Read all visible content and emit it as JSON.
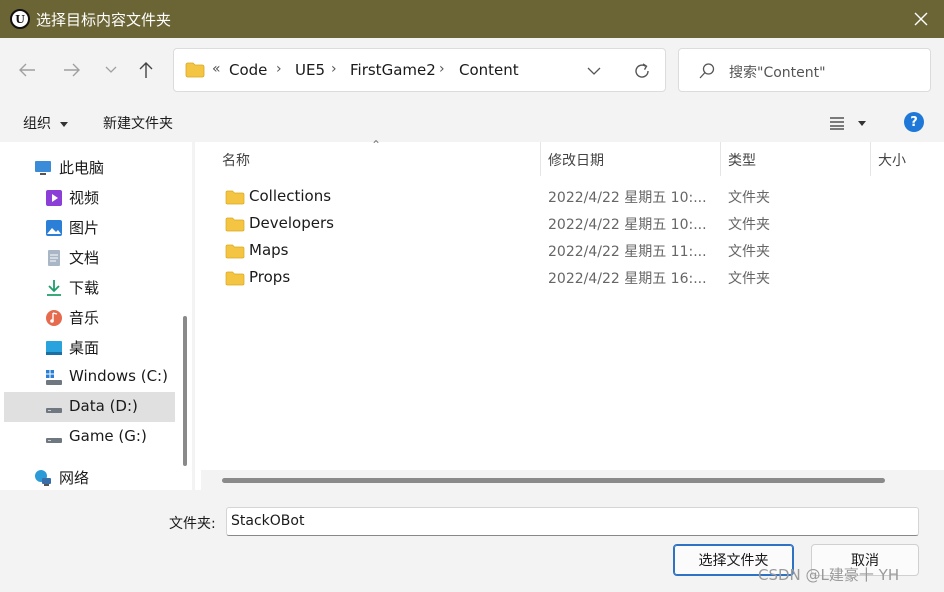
{
  "window": {
    "title": "选择目标内容文件夹",
    "app_icon_letter": "U"
  },
  "address_bar": {
    "overflow": "«",
    "crumbs": [
      "Code",
      "UE5",
      "FirstGame2",
      "Content"
    ]
  },
  "search": {
    "placeholder": "搜索\"Content\""
  },
  "toolbar": {
    "organize_label": "组织",
    "new_folder_label": "新建文件夹"
  },
  "sidebar": {
    "items": [
      {
        "label": "此电脑",
        "icon": "computer-icon"
      },
      {
        "label": "视频",
        "icon": "videos-icon"
      },
      {
        "label": "图片",
        "icon": "pictures-icon"
      },
      {
        "label": "文档",
        "icon": "documents-icon"
      },
      {
        "label": "下载",
        "icon": "downloads-icon"
      },
      {
        "label": "音乐",
        "icon": "music-icon"
      },
      {
        "label": "桌面",
        "icon": "desktop-icon"
      },
      {
        "label": "Windows (C:)",
        "icon": "windows-drive-icon"
      },
      {
        "label": "Data (D:)",
        "icon": "drive-icon",
        "selected": true
      },
      {
        "label": "Game (G:)",
        "icon": "drive-icon"
      },
      {
        "label": "网络",
        "icon": "network-icon"
      }
    ]
  },
  "file_list": {
    "columns": [
      "名称",
      "修改日期",
      "类型",
      "大小"
    ],
    "rows": [
      {
        "name": "Collections",
        "date": "2022/4/22 星期五 10:...",
        "type": "文件夹"
      },
      {
        "name": "Developers",
        "date": "2022/4/22 星期五 10:...",
        "type": "文件夹"
      },
      {
        "name": "Maps",
        "date": "2022/4/22 星期五 11:...",
        "type": "文件夹"
      },
      {
        "name": "Props",
        "date": "2022/4/22 星期五 16:...",
        "type": "文件夹"
      }
    ]
  },
  "footer": {
    "folder_label": "文件夹:",
    "folder_value": "StackOBot",
    "select_button": "选择文件夹",
    "cancel_button": "取消",
    "watermark": "CSDN @L建豪十 YH"
  },
  "colors": {
    "titlebar": "#6b6434",
    "folder": "#f4c542",
    "accent": "#2f72c4",
    "help": "#1e78d7"
  }
}
